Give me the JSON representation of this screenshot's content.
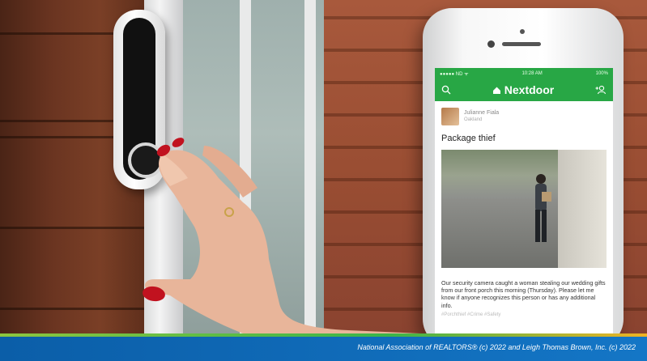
{
  "phone": {
    "status": {
      "carrier": "●●●●● ND ᯤ",
      "time": "10:28 AM",
      "battery": "100%"
    },
    "app": {
      "name": "Nextdoor",
      "accent": "#28a745"
    },
    "post": {
      "author": "Julianne Fiala",
      "author_sub": "Oakland",
      "title": "Package thief",
      "body": "Our security camera caught a woman stealing our wedding gifts from our front porch this morning (Thursday). Please let me know if anyone recognizes this person or has any additional info.",
      "tags": "#Porchthief #Crime #Safety"
    },
    "icons": {
      "search": "search-icon",
      "add_neighbor": "add-person-icon",
      "logo": "house-icon"
    }
  },
  "footer": {
    "copyright": "National Association of REALTORS® (c) 2022 and Leigh Thomas Brown, Inc. (c) 2022"
  }
}
